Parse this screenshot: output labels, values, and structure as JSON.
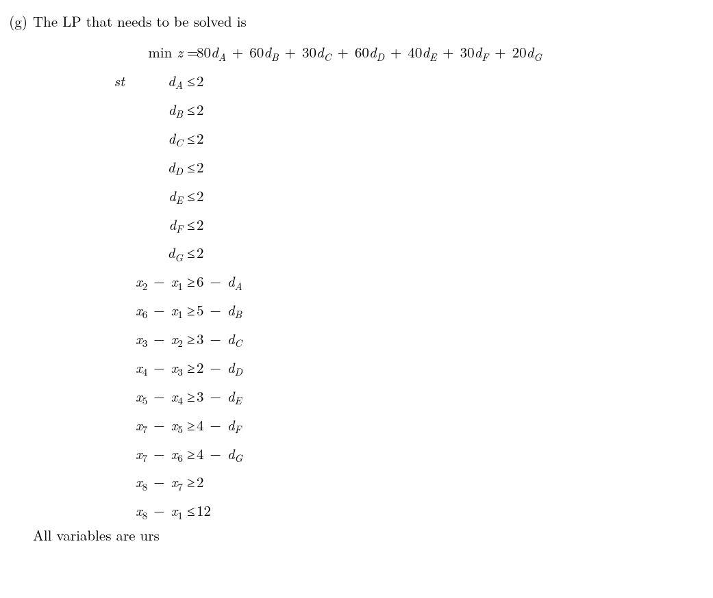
{
  "item_label": "(g)",
  "intro": "The LP that needs to be solved is",
  "closing": "All variables are urs",
  "min_label": "min",
  "st_label": "st",
  "objective": {
    "lhs_var": "z",
    "rel": "=",
    "terms": [
      {
        "coef": "80",
        "var": "d",
        "sub": "A"
      },
      {
        "coef": "60",
        "var": "d",
        "sub": "B"
      },
      {
        "coef": "30",
        "var": "d",
        "sub": "C"
      },
      {
        "coef": "60",
        "var": "d",
        "sub": "D"
      },
      {
        "coef": "40",
        "var": "d",
        "sub": "E"
      },
      {
        "coef": "30",
        "var": "d",
        "sub": "F"
      },
      {
        "coef": "20",
        "var": "d",
        "sub": "G"
      }
    ]
  },
  "d_bounds": [
    {
      "var": "d",
      "sub": "A",
      "rel": "≤",
      "rhs": "2"
    },
    {
      "var": "d",
      "sub": "B",
      "rel": "≤",
      "rhs": "2"
    },
    {
      "var": "d",
      "sub": "C",
      "rel": "≤",
      "rhs": "2"
    },
    {
      "var": "d",
      "sub": "D",
      "rel": "≤",
      "rhs": "2"
    },
    {
      "var": "d",
      "sub": "E",
      "rel": "≤",
      "rhs": "2"
    },
    {
      "var": "d",
      "sub": "F",
      "rel": "≤",
      "rhs": "2"
    },
    {
      "var": "d",
      "sub": "G",
      "rel": "≤",
      "rhs": "2"
    }
  ],
  "x_constraints": [
    {
      "xa": "2",
      "xb": "1",
      "rel": "≥",
      "c": "6",
      "dsub": "A"
    },
    {
      "xa": "6",
      "xb": "1",
      "rel": "≥",
      "c": "5",
      "dsub": "B"
    },
    {
      "xa": "3",
      "xb": "2",
      "rel": "≥",
      "c": "3",
      "dsub": "C"
    },
    {
      "xa": "4",
      "xb": "3",
      "rel": "≥",
      "c": "2",
      "dsub": "D"
    },
    {
      "xa": "5",
      "xb": "4",
      "rel": "≥",
      "c": "3",
      "dsub": "E"
    },
    {
      "xa": "7",
      "xb": "5",
      "rel": "≥",
      "c": "4",
      "dsub": "F"
    },
    {
      "xa": "7",
      "xb": "6",
      "rel": "≥",
      "c": "4",
      "dsub": "G"
    }
  ],
  "simple_constraints": [
    {
      "xa": "8",
      "xb": "7",
      "rel": "≥",
      "c": "2"
    },
    {
      "xa": "8",
      "xb": "1",
      "rel": "≤",
      "c": "12"
    }
  ]
}
